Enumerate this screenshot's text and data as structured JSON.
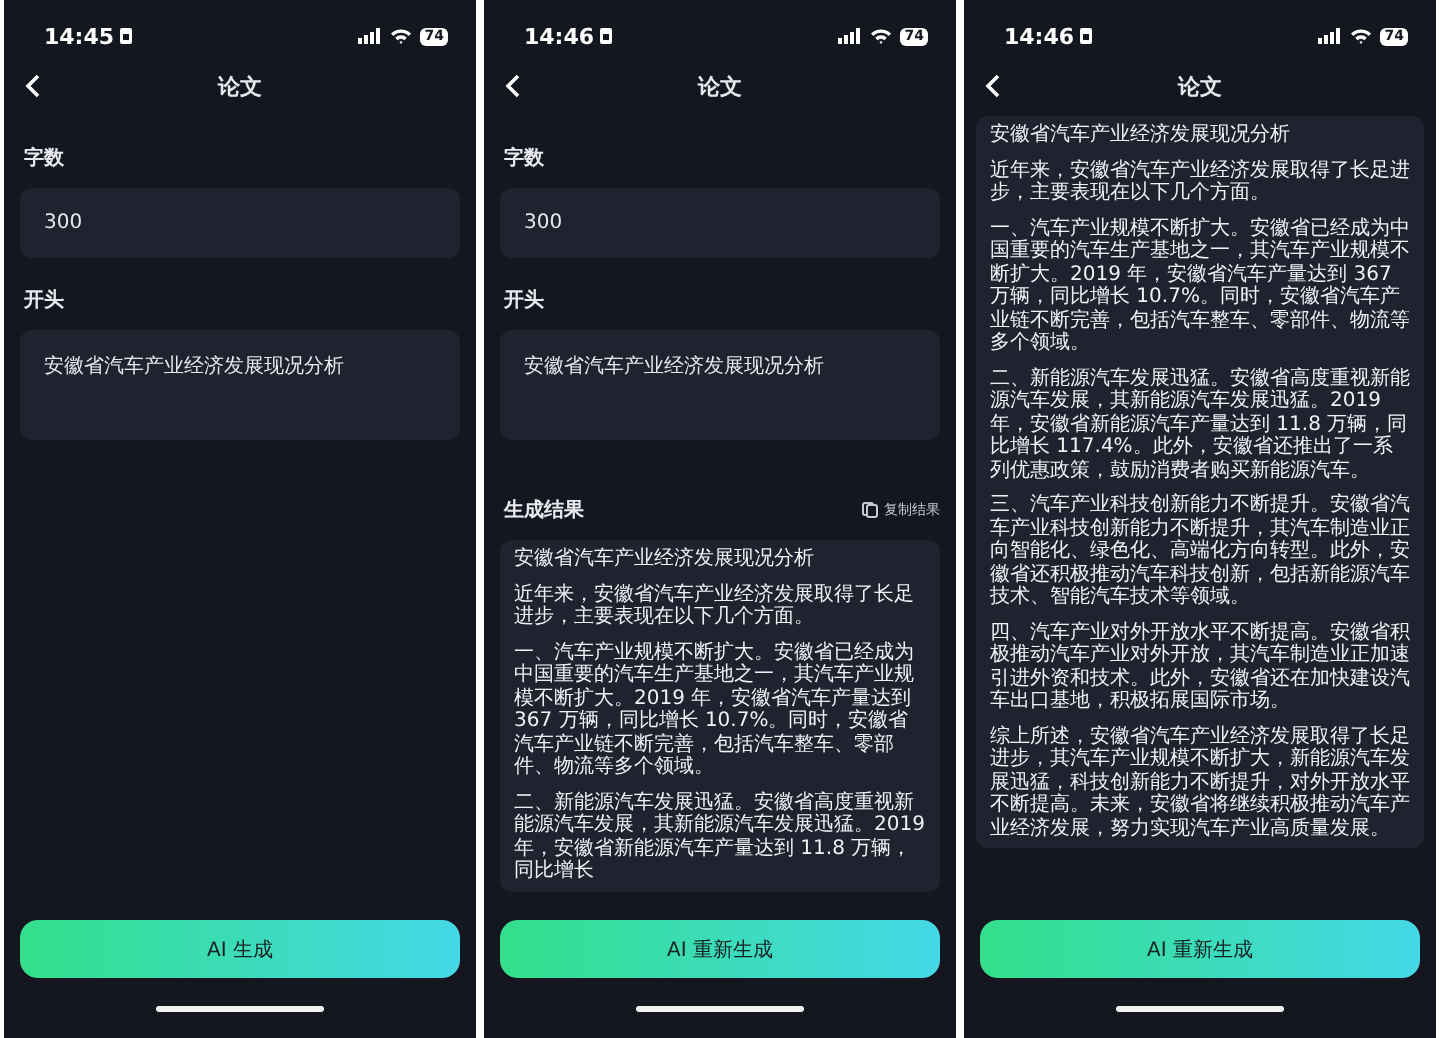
{
  "phones": [
    {
      "status_bar": {
        "time": "14:45",
        "battery": "74"
      },
      "title": "论文",
      "form": [
        {
          "label": "字数",
          "value": "300",
          "kind": "short"
        },
        {
          "label": "开头",
          "value": "安徽省汽车产业经济发展现况分析",
          "kind": "long"
        }
      ],
      "button": "AI 生成"
    },
    {
      "status_bar": {
        "time": "14:46",
        "battery": "74"
      },
      "title": "论文",
      "form": [
        {
          "label": "字数",
          "value": "300",
          "kind": "short"
        },
        {
          "label": "开头",
          "value": "安徽省汽车产业经济发展现况分析",
          "kind": "long"
        }
      ],
      "result": {
        "heading": "生成结果",
        "copy_label": "复制结果",
        "paragraphs": [
          "安徽省汽车产业经济发展现况分析",
          "近年来，安徽省汽车产业经济发展取得了长足进步，主要表现在以下几个方面。",
          "一、汽车产业规模不断扩大。安徽省已经成为中国重要的汽车生产基地之一，其汽车产业规模不断扩大。2019 年，安徽省汽车产量达到 367 万辆，同比增长 10.7%。同时，安徽省汽车产业链不断完善，包括汽车整车、零部件、物流等多个领域。",
          "二、新能源汽车发展迅猛。安徽省高度重视新能源汽车发展，其新能源汽车发展迅猛。2019 年，安徽省新能源汽车产量达到 11.8 万辆，同比增长"
        ]
      },
      "button": "AI 重新生成"
    },
    {
      "status_bar": {
        "time": "14:46",
        "battery": "74"
      },
      "title": "论文",
      "result": {
        "paragraphs": [
          "安徽省汽车产业经济发展现况分析",
          "近年来，安徽省汽车产业经济发展取得了长足进步，主要表现在以下几个方面。",
          "一、汽车产业规模不断扩大。安徽省已经成为中国重要的汽车生产基地之一，其汽车产业规模不断扩大。2019 年，安徽省汽车产量达到 367 万辆，同比增长 10.7%。同时，安徽省汽车产业链不断完善，包括汽车整车、零部件、物流等多个领域。",
          "二、新能源汽车发展迅猛。安徽省高度重视新能源汽车发展，其新能源汽车发展迅猛。2019 年，安徽省新能源汽车产量达到 11.8 万辆，同比增长 117.4%。此外，安徽省还推出了一系列优惠政策，鼓励消费者购买新能源汽车。",
          "三、汽车产业科技创新能力不断提升。安徽省汽车产业科技创新能力不断提升，其汽车制造业正向智能化、绿色化、高端化方向转型。此外，安徽省还积极推动汽车科技创新，包括新能源汽车技术、智能汽车技术等领域。",
          "四、汽车产业对外开放水平不断提高。安徽省积极推动汽车产业对外开放，其汽车制造业正加速引进外资和技术。此外，安徽省还在加快建设汽车出口基地，积极拓展国际市场。",
          "综上所述，安徽省汽车产业经济发展取得了长足进步，其汽车产业规模不断扩大，新能源汽车发展迅猛，科技创新能力不断提升，对外开放水平不断提高。未来，安徽省将继续积极推动汽车产业经济发展，努力实现汽车产业高质量发展。"
        ]
      },
      "button": "AI 重新生成"
    }
  ]
}
